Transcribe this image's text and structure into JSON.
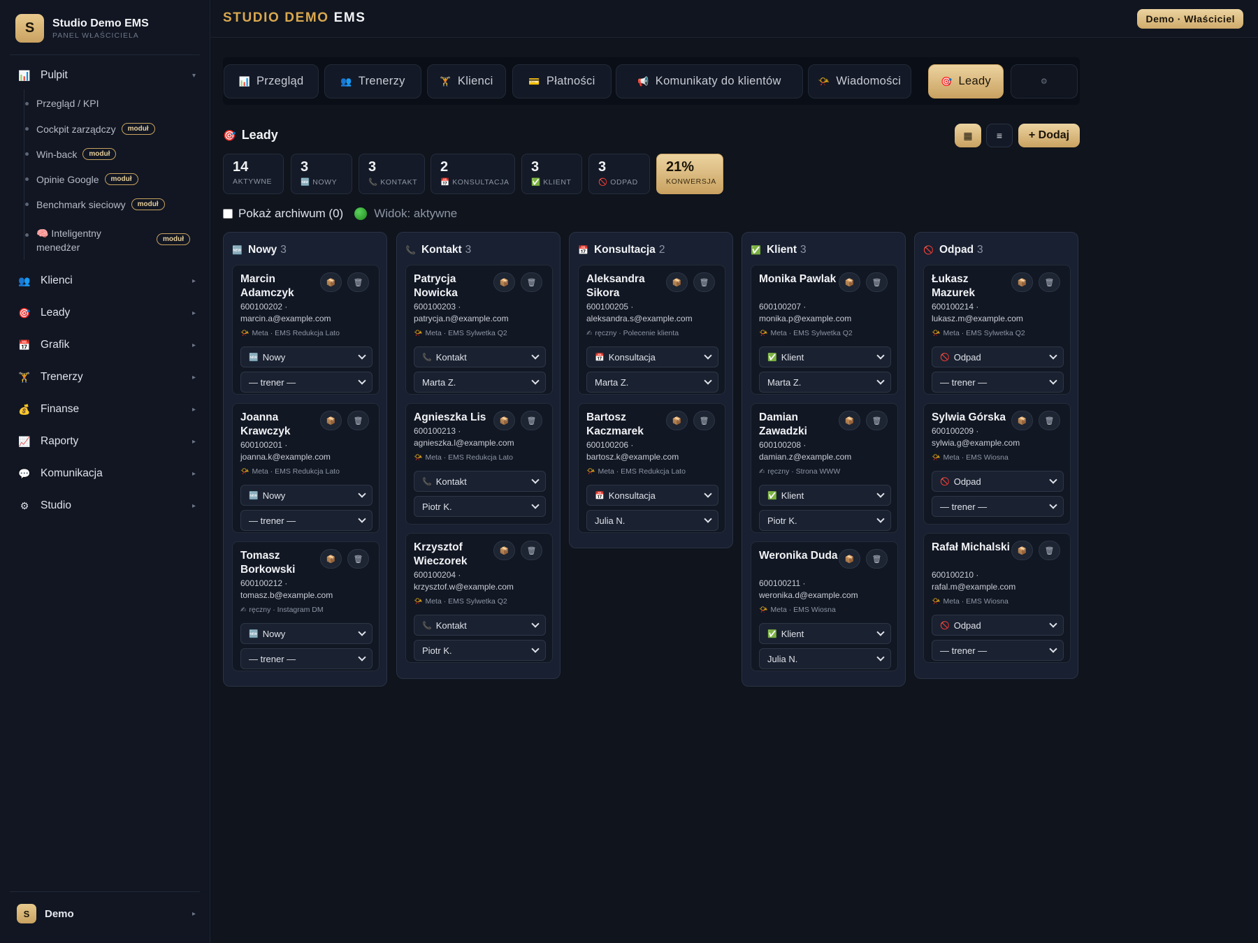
{
  "sidebar": {
    "brand_initial": "S",
    "brand_name": "Studio Demo EMS",
    "brand_sub": "PANEL WŁAŚCICIELA",
    "pulpit": "Pulpit",
    "sub_items": [
      {
        "label": "Przegląd / KPI",
        "badge": ""
      },
      {
        "label": "Cockpit zarządczy",
        "badge": "moduł"
      },
      {
        "label": "Win-back",
        "badge": "moduł"
      },
      {
        "label": "Opinie Google",
        "badge": "moduł"
      },
      {
        "label": "Benchmark sieciowy",
        "badge": "moduł"
      },
      {
        "label": "🧠 Inteligentny menedżer",
        "badge": "moduł"
      }
    ],
    "nav": [
      {
        "label": "Klienci",
        "icon": "👥"
      },
      {
        "label": "Leady",
        "icon": "🎯"
      },
      {
        "label": "Grafik",
        "icon": "📅"
      },
      {
        "label": "Trenerzy",
        "icon": "🏋"
      },
      {
        "label": "Finanse",
        "icon": "💰"
      },
      {
        "label": "Raporty",
        "icon": "📈"
      },
      {
        "label": "Komunikacja",
        "icon": "💬"
      },
      {
        "label": "Studio",
        "icon": "⚙"
      }
    ],
    "pulpit_icon": "📊",
    "user_initial": "S",
    "user_name": "Demo"
  },
  "header": {
    "title_a": "STUDIO DEMO",
    "title_b": "EMS",
    "role": "Demo · Właściciel"
  },
  "tabs": [
    {
      "label": "Przegląd",
      "icon": "📊"
    },
    {
      "label": "Trenerzy",
      "icon": "👥"
    },
    {
      "label": "Klienci",
      "icon": "🏋"
    },
    {
      "label": "Płatności",
      "icon": "💳"
    },
    {
      "label": "Komunikaty do klientów",
      "icon": "📢"
    },
    {
      "label": "Wiadomości",
      "icon": "📯"
    },
    {
      "label": "Leady",
      "icon": "🎯"
    },
    {
      "label": "",
      "icon": "⚙"
    }
  ],
  "leads": {
    "title": "Leady",
    "title_icon": "🎯",
    "view_grid": "▦",
    "view_list": "≡",
    "add_label": "+ Dodaj",
    "stats": [
      {
        "value": "14",
        "label": "AKTYWNE"
      },
      {
        "value": "3",
        "label": "🆕 NOWY"
      },
      {
        "value": "3",
        "label": "📞 KONTAKT"
      },
      {
        "value": "2",
        "label": "📅 KONSULTACJA"
      },
      {
        "value": "3",
        "label": "✅ KLIENT"
      },
      {
        "value": "3",
        "label": "🚫 ODPAD"
      },
      {
        "value": "21%",
        "label": "KONWERSJA"
      }
    ],
    "archive_label": "Pokaż archiwum (0)",
    "view_label": "Widok: aktywne"
  },
  "columns": [
    {
      "name": "Nowy",
      "icon": "🆕",
      "count": "3",
      "cards": [
        {
          "name": "Marcin Adamczyk",
          "phone": "600100202 ·",
          "email": "marcin.a@example.com",
          "src_icon": "📯",
          "source": "Meta · EMS Redukcja Lato",
          "stage_icon": "🆕",
          "stage": "Nowy",
          "trainer": "— trener —"
        },
        {
          "name": "Joanna Krawczyk",
          "phone": "600100201 ·",
          "email": "joanna.k@example.com",
          "src_icon": "📯",
          "source": "Meta · EMS Redukcja Lato",
          "stage_icon": "🆕",
          "stage": "Nowy",
          "trainer": "— trener —"
        },
        {
          "name": "Tomasz Borkowski",
          "phone": "600100212 ·",
          "email": "tomasz.b@example.com",
          "src_icon": "✍",
          "source": "ręczny · Instagram DM",
          "stage_icon": "🆕",
          "stage": "Nowy",
          "trainer": "— trener —"
        }
      ]
    },
    {
      "name": "Kontakt",
      "icon": "📞",
      "count": "3",
      "cards": [
        {
          "name": "Patrycja Nowicka",
          "phone": "600100203 ·",
          "email": "patrycja.n@example.com",
          "src_icon": "📯",
          "source": "Meta · EMS Sylwetka Q2",
          "stage_icon": "📞",
          "stage": "Kontakt",
          "trainer": "Marta Z."
        },
        {
          "name": "Agnieszka Lis",
          "phone": "600100213 ·",
          "email": "agnieszka.l@example.com",
          "src_icon": "📯",
          "source": "Meta · EMS Redukcja Lato",
          "stage_icon": "📞",
          "stage": "Kontakt",
          "trainer": "Piotr K."
        },
        {
          "name": "Krzysztof Wieczorek",
          "phone": "600100204 ·",
          "email": "krzysztof.w@example.com",
          "src_icon": "📯",
          "source": "Meta · EMS Sylwetka Q2",
          "stage_icon": "📞",
          "stage": "Kontakt",
          "trainer": "Piotr K."
        }
      ]
    },
    {
      "name": "Konsultacja",
      "icon": "📅",
      "count": "2",
      "cards": [
        {
          "name": "Aleksandra Sikora",
          "phone": "600100205 ·",
          "email": "aleksandra.s@example.com",
          "src_icon": "✍",
          "source": "ręczny · Polecenie klienta",
          "stage_icon": "📅",
          "stage": "Konsultacja",
          "trainer": "Marta Z."
        },
        {
          "name": "Bartosz Kaczmarek",
          "phone": "600100206 ·",
          "email": "bartosz.k@example.com",
          "src_icon": "📯",
          "source": "Meta · EMS Redukcja Lato",
          "stage_icon": "📅",
          "stage": "Konsultacja",
          "trainer": "Julia N."
        }
      ]
    },
    {
      "name": "Klient",
      "icon": "✅",
      "count": "3",
      "cards": [
        {
          "name": "Monika Pawlak",
          "phone": "600100207 ·",
          "email": "monika.p@example.com",
          "src_icon": "📯",
          "source": "Meta · EMS Sylwetka Q2",
          "stage_icon": "✅",
          "stage": "Klient",
          "trainer": "Marta Z."
        },
        {
          "name": "Damian Zawadzki",
          "phone": "600100208 ·",
          "email": "damian.z@example.com",
          "src_icon": "✍",
          "source": "ręczny · Strona WWW",
          "stage_icon": "✅",
          "stage": "Klient",
          "trainer": "Piotr K."
        },
        {
          "name": "Weronika Duda",
          "phone": "600100211 ·",
          "email": "weronika.d@example.com",
          "src_icon": "📯",
          "source": "Meta · EMS Wiosna",
          "stage_icon": "✅",
          "stage": "Klient",
          "trainer": "Julia N."
        }
      ]
    },
    {
      "name": "Odpad",
      "icon": "🚫",
      "count": "3",
      "cards": [
        {
          "name": "Łukasz Mazurek",
          "phone": "600100214 ·",
          "email": "lukasz.m@example.com",
          "src_icon": "📯",
          "source": "Meta · EMS Sylwetka Q2",
          "stage_icon": "🚫",
          "stage": "Odpad",
          "trainer": "— trener —"
        },
        {
          "name": "Sylwia Górska",
          "phone": "600100209 ·",
          "email": "sylwia.g@example.com",
          "src_icon": "📯",
          "source": "Meta · EMS Wiosna",
          "stage_icon": "🚫",
          "stage": "Odpad",
          "trainer": "— trener —"
        },
        {
          "name": "Rafał Michalski",
          "phone": "600100210 ·",
          "email": "rafal.m@example.com",
          "src_icon": "📯",
          "source": "Meta · EMS Wiosna",
          "stage_icon": "🚫",
          "stage": "Odpad",
          "trainer": "— trener —"
        }
      ]
    }
  ],
  "card_actions": {
    "archive_icon": "📦",
    "delete_icon": "🗑"
  },
  "colors": {
    "accent": "#c9a261",
    "accent_light": "#ecd3a0",
    "title_gold": "#d9a84f",
    "background": "#0f141d"
  }
}
